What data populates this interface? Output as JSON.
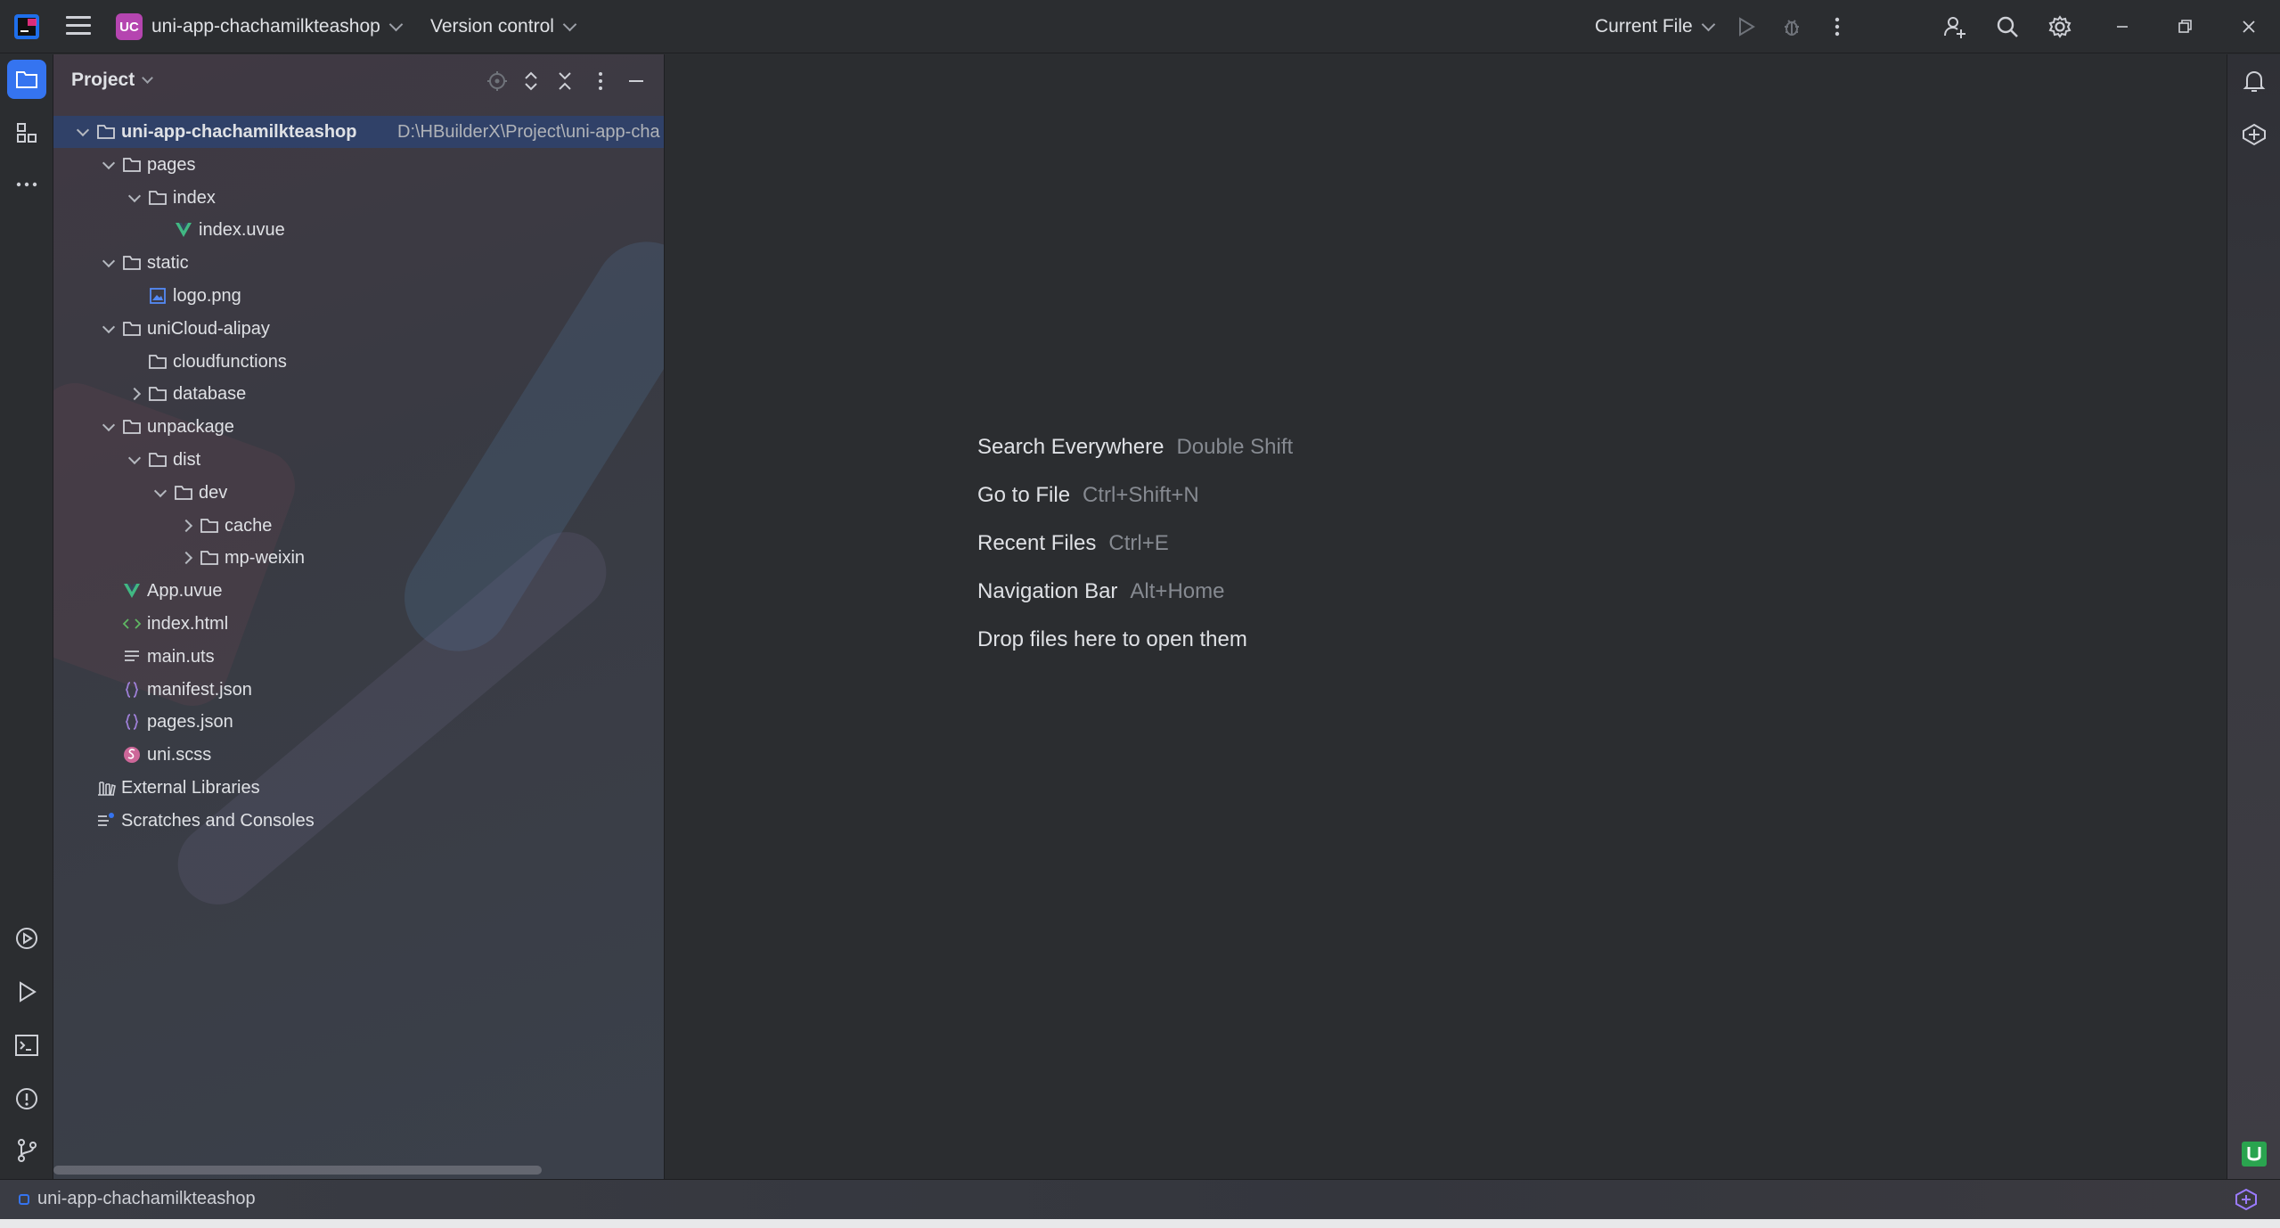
{
  "titlebar": {
    "project_badge": "UC",
    "project_name": "uni-app-chachamilkteashop",
    "vcs_label": "Version control",
    "run_config": "Current File"
  },
  "project_panel": {
    "title": "Project",
    "tree": [
      {
        "label": "uni-app-chachamilkteashop",
        "path": "D:\\HBuilderX\\Project\\uni-app-cha",
        "icon": "folder-icon",
        "depth": 0,
        "expanded": true,
        "selected": true
      },
      {
        "label": "pages",
        "icon": "folder-icon",
        "depth": 1,
        "expanded": true
      },
      {
        "label": "index",
        "icon": "folder-icon",
        "depth": 2,
        "expanded": true
      },
      {
        "label": "index.uvue",
        "icon": "vue-file-icon",
        "depth": 3
      },
      {
        "label": "static",
        "icon": "folder-icon",
        "depth": 1,
        "expanded": true
      },
      {
        "label": "logo.png",
        "icon": "image-file-icon",
        "depth": 2
      },
      {
        "label": "uniCloud-alipay",
        "icon": "folder-icon",
        "depth": 1,
        "expanded": true
      },
      {
        "label": "cloudfunctions",
        "icon": "folder-icon",
        "depth": 2
      },
      {
        "label": "database",
        "icon": "folder-icon",
        "depth": 2,
        "expanded": false
      },
      {
        "label": "unpackage",
        "icon": "folder-icon",
        "depth": 1,
        "expanded": true
      },
      {
        "label": "dist",
        "icon": "folder-icon",
        "depth": 2,
        "expanded": true
      },
      {
        "label": "dev",
        "icon": "folder-icon",
        "depth": 3,
        "expanded": true
      },
      {
        "label": "cache",
        "icon": "folder-icon",
        "depth": 4,
        "expanded": false
      },
      {
        "label": "mp-weixin",
        "icon": "folder-icon",
        "depth": 4,
        "expanded": false
      },
      {
        "label": "App.uvue",
        "icon": "vue-file-icon",
        "depth": 1
      },
      {
        "label": "index.html",
        "icon": "html-file-icon",
        "depth": 1
      },
      {
        "label": "main.uts",
        "icon": "text-file-icon",
        "depth": 1
      },
      {
        "label": "manifest.json",
        "icon": "json-file-icon",
        "depth": 1
      },
      {
        "label": "pages.json",
        "icon": "json-file-icon",
        "depth": 1
      },
      {
        "label": "uni.scss",
        "icon": "scss-file-icon",
        "depth": 1
      },
      {
        "label": "External Libraries",
        "icon": "library-icon",
        "depth": 0
      },
      {
        "label": "Scratches and Consoles",
        "icon": "scratches-icon",
        "depth": 0
      }
    ]
  },
  "editor": {
    "hints": [
      {
        "action": "Search Everywhere",
        "shortcut": "Double Shift"
      },
      {
        "action": "Go to File",
        "shortcut": "Ctrl+Shift+N"
      },
      {
        "action": "Recent Files",
        "shortcut": "Ctrl+E"
      },
      {
        "action": "Navigation Bar",
        "shortcut": "Alt+Home"
      },
      {
        "action": "Drop files here to open them",
        "shortcut": ""
      }
    ]
  },
  "statusbar": {
    "project_name": "uni-app-chachamilkteashop"
  },
  "colors": {
    "accent": "#3574f0",
    "badge": "#b545b0",
    "vue": "#41b883",
    "background": "#2b2d30"
  }
}
